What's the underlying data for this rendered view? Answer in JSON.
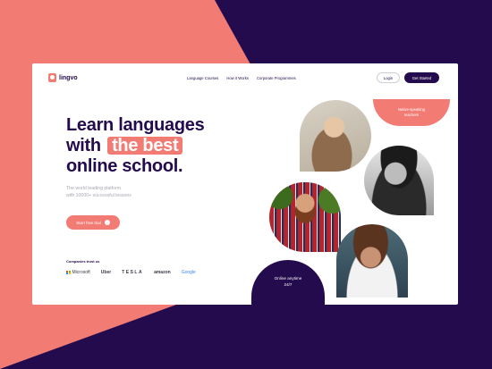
{
  "brand": {
    "name": "lingvo"
  },
  "nav": {
    "items": [
      "Language Courses",
      "How it Works",
      "Corporate Programmes"
    ]
  },
  "header": {
    "login_label": "Login",
    "cta_label": "Get Started"
  },
  "hero": {
    "title_line1": "Learn languages",
    "title_line2_pre": "with",
    "title_highlight": "the best",
    "title_line3": "online school.",
    "subtitle_line1": "The world leading platform",
    "subtitle_line2": "with 10000+ successful lessons",
    "cta_label": "Start free trial"
  },
  "companies": {
    "label": "Companies trust us",
    "logos": [
      "Microsoft",
      "Uber",
      "TESLA",
      "amazon",
      "Google"
    ]
  },
  "badges": {
    "native_line1": "Native-speaking",
    "native_line2": "teachers",
    "online_line1": "Online anytime",
    "online_line2": "24/7"
  },
  "colors": {
    "accent": "#f27b74",
    "brand_dark": "#240b4e",
    "surface": "#ffffff"
  },
  "icons": {
    "cta_arrow": "arrow-right-icon",
    "logo": "chat-bubble-icon"
  }
}
